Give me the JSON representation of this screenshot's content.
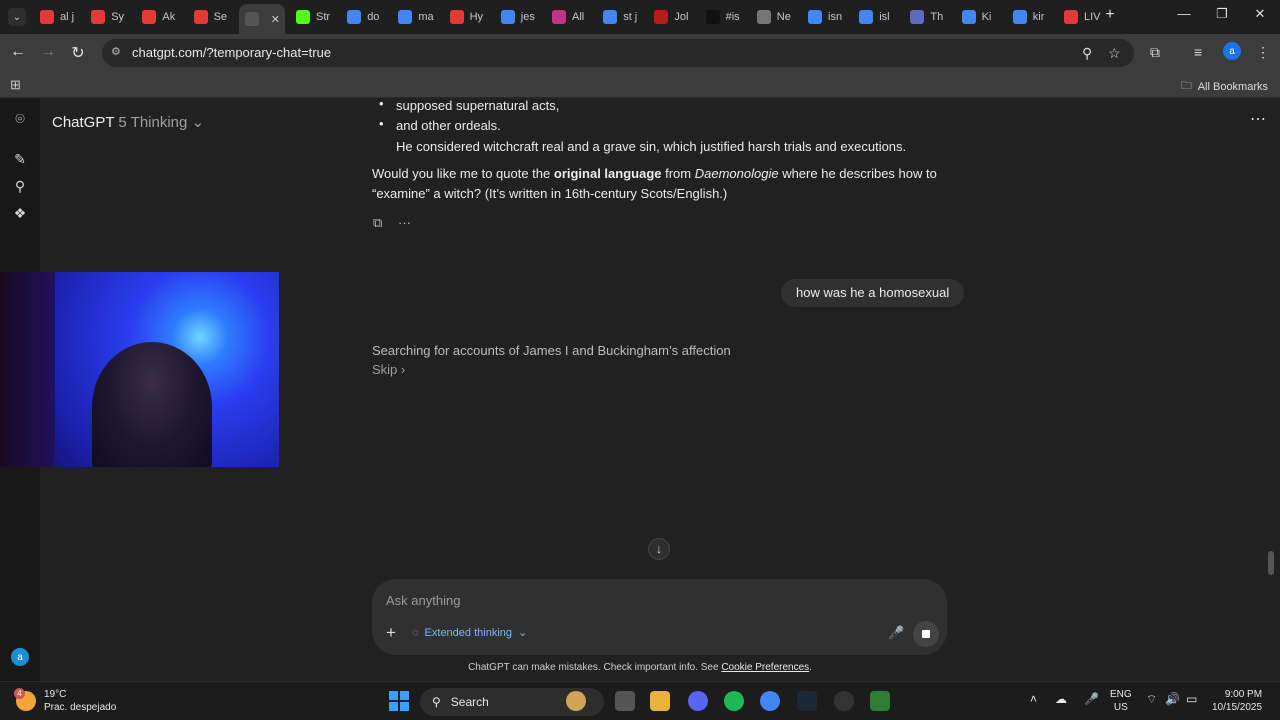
{
  "browser": {
    "tabs": [
      {
        "label": "al j",
        "color": "#e53935",
        "icon": "youtube-icon"
      },
      {
        "label": "Sy",
        "color": "#e53935",
        "icon": "youtube-icon"
      },
      {
        "label": "Ak",
        "color": "#e53935",
        "icon": "youtube-icon"
      },
      {
        "label": "Se",
        "color": "#e53935",
        "icon": "youtube-icon"
      },
      {
        "label": "",
        "color": "#555555",
        "icon": "chatgpt-icon",
        "active": true
      },
      {
        "label": "Str",
        "color": "#53fc18",
        "icon": "kick-icon"
      },
      {
        "label": "do",
        "color": "#4285f4",
        "icon": "google-icon"
      },
      {
        "label": "ma",
        "color": "#4285f4",
        "icon": "google-icon"
      },
      {
        "label": "Hy",
        "color": "#e53935",
        "icon": "youtube-icon"
      },
      {
        "label": "jes",
        "color": "#4285f4",
        "icon": "google-icon"
      },
      {
        "label": "All",
        "color": "#c13584",
        "icon": "instagram-icon"
      },
      {
        "label": "st j",
        "color": "#4285f4",
        "icon": "google-icon"
      },
      {
        "label": "Jol",
        "color": "#b71c1c",
        "icon": "loading-icon"
      },
      {
        "label": "#is",
        "color": "#111111",
        "icon": "tiktok-icon"
      },
      {
        "label": "Ne",
        "color": "#777777",
        "icon": "web-icon"
      },
      {
        "label": "isn",
        "color": "#4285f4",
        "icon": "google-icon"
      },
      {
        "label": "isl",
        "color": "#4285f4",
        "icon": "google-icon"
      },
      {
        "label": "Th",
        "color": "#5c6bc0",
        "icon": "user-icon"
      },
      {
        "label": "Ki",
        "color": "#4285f4",
        "icon": "google-icon"
      },
      {
        "label": "kir",
        "color": "#4285f4",
        "icon": "google-icon"
      },
      {
        "label": "LIV",
        "color": "#e53935",
        "icon": "youtube-icon"
      }
    ],
    "url": "chatgpt.com/?temporary-chat=true",
    "all_bookmarks": "All Bookmarks",
    "profile_letter": "a"
  },
  "chat": {
    "model_name": "ChatGPT",
    "model_version": "5 Thinking",
    "bullets": [
      "supposed supernatural acts,",
      "and other ordeals."
    ],
    "indent_line": "He considered witchcraft real and a grave sin, which justified harsh trials and executions.",
    "question_parts": {
      "p1": "Would you like me to quote the ",
      "bold": "original language",
      "p2": " from ",
      "italic": "Daemonologie",
      "p3": " where he describes how to “examine” a witch? (It’s written in 16th-century Scots/English.)"
    },
    "user_message": "how was he a homosexual",
    "status": "Searching for accounts of James I and Buckingham’s affection",
    "skip": "Skip",
    "composer_placeholder": "Ask anything",
    "extended_thinking": "Extended thinking",
    "disclaimer": "ChatGPT can make mistakes. Check important info. See ",
    "cookie_link": "Cookie Preferences",
    "avatar_letter": "a"
  },
  "taskbar": {
    "weather_badge": "4",
    "temp": "19°C",
    "condition": "Prac. despejado",
    "search": "Search",
    "lang_top": "ENG",
    "lang_bottom": "US",
    "time": "9:00 PM",
    "date": "10/15/2025"
  }
}
